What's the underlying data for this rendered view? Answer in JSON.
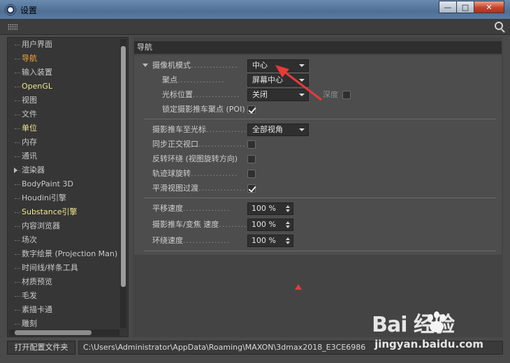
{
  "window": {
    "title": "设置",
    "min_label": "—",
    "max_label": "□",
    "close_label": "✕"
  },
  "sidebar": {
    "items": [
      {
        "label": "用户界面",
        "state": "normal"
      },
      {
        "label": "导航",
        "state": "active"
      },
      {
        "label": "输入装置",
        "state": "normal"
      },
      {
        "label": "OpenGL",
        "state": "hl"
      },
      {
        "label": "视图",
        "state": "normal"
      },
      {
        "label": "文件",
        "state": "normal"
      },
      {
        "label": "单位",
        "state": "hl"
      },
      {
        "label": "内存",
        "state": "normal"
      },
      {
        "label": "通讯",
        "state": "normal"
      },
      {
        "label": "渲染器",
        "state": "normal",
        "expandable": true
      },
      {
        "label": "BodyPaint 3D",
        "state": "normal"
      },
      {
        "label": "Houdini引擎",
        "state": "normal"
      },
      {
        "label": "Substance引擎",
        "state": "hl"
      },
      {
        "label": "内容浏览器",
        "state": "normal"
      },
      {
        "label": "场次",
        "state": "normal"
      },
      {
        "label": "数字绘景 (Projection Man)",
        "state": "normal"
      },
      {
        "label": "时间线/样条工具",
        "state": "normal"
      },
      {
        "label": "材质预览",
        "state": "normal"
      },
      {
        "label": "毛发",
        "state": "normal"
      },
      {
        "label": "素描卡通",
        "state": "normal"
      },
      {
        "label": "雕刻",
        "state": "normal"
      }
    ]
  },
  "main": {
    "section_title": "导航",
    "camera_mode": {
      "label": "摄像机模式",
      "value": "中心"
    },
    "focus": {
      "label": "聚点",
      "value": "屏幕中心"
    },
    "cursor_pos": {
      "label": "光标位置",
      "value": "关闭"
    },
    "depth": {
      "label": "深度",
      "checked": false
    },
    "lock_poi": {
      "label": "锁定摄影推车聚点 (POI)",
      "checked": true
    },
    "dolly_cursor": {
      "label": "摄影推车至光标",
      "value": "全部视角"
    },
    "sync_ortho": {
      "label": "同步正交视口",
      "checked": false
    },
    "reverse_orbit": {
      "label": "反转环绕 (视图旋转方向)",
      "checked": false
    },
    "trackball": {
      "label": "轨迹球旋转",
      "checked": false
    },
    "smooth_transition": {
      "label": "平滑视图过渡",
      "checked": true
    },
    "pan_speed": {
      "label": "平移速度",
      "value": "100 %"
    },
    "dolly_speed": {
      "label": "摄影推车/变焦 速度",
      "value": "100 %"
    },
    "orbit_speed": {
      "label": "环绕速度",
      "value": "100 %"
    },
    "dots": "..............."
  },
  "bottom": {
    "open_button": "打开配置文件夹",
    "path": "C:\\Users\\Administrator\\AppData\\Roaming\\MAXON\\3dmax2018_E3CE6986"
  },
  "watermark": {
    "logo": "Bai 经验",
    "url": "jingyan.baidu.com"
  },
  "colors": {
    "active": "#f5a43a",
    "highlight": "#f0e68c",
    "annotation": "#e83a3a"
  }
}
